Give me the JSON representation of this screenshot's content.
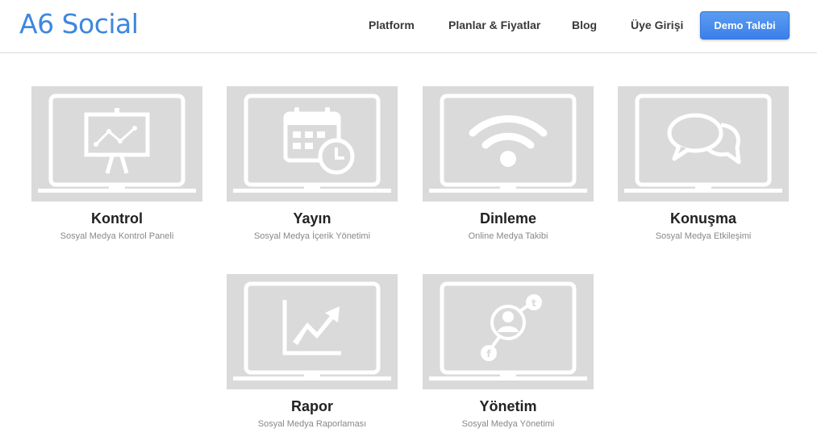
{
  "header": {
    "logo": "A6 Social",
    "nav": {
      "platform": "Platform",
      "plans": "Planlar & Fiyatlar",
      "blog": "Blog",
      "login": "Üye Girişi"
    },
    "demo_button": "Demo Talebi"
  },
  "cards": [
    {
      "title": "Kontrol",
      "subtitle": "Sosyal Medya Kontrol Paneli",
      "icon": "presentation-chart-icon"
    },
    {
      "title": "Yayın",
      "subtitle": "Sosyal Medya İçerik Yönetimi",
      "icon": "calendar-clock-icon"
    },
    {
      "title": "Dinleme",
      "subtitle": "Online Medya Takibi",
      "icon": "wifi-icon"
    },
    {
      "title": "Konuşma",
      "subtitle": "Sosyal Medya Etkileşimi",
      "icon": "chat-bubbles-icon"
    },
    {
      "title": "Rapor",
      "subtitle": "Sosyal Medya Raporlaması",
      "icon": "trend-chart-icon"
    },
    {
      "title": "Yönetim",
      "subtitle": "Sosyal Medya Yönetimi",
      "icon": "social-network-icon"
    }
  ],
  "colors": {
    "brand": "#3f87e0",
    "button": "#3b80ea",
    "tile_background": "#dadada",
    "icon_stroke": "#ffffff"
  }
}
